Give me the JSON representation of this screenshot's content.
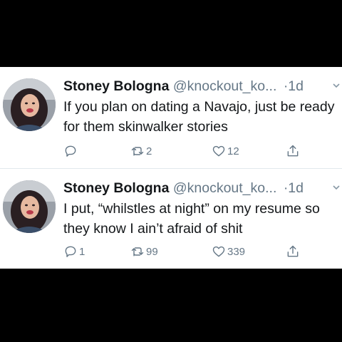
{
  "tweets": [
    {
      "name": "Stoney Bologna",
      "handle": "@knockout_ko...",
      "time": "·1d",
      "text": "If you plan on dating a Navajo, just be ready for them skinwalker stories",
      "replies": "",
      "retweets": "2",
      "likes": "12"
    },
    {
      "name": "Stoney Bologna",
      "handle": "@knockout_ko...",
      "time": "·1d",
      "text": "I put, “whilstles at night” on my resume so they know I ain’t afraid of shit",
      "replies": "1",
      "retweets": "99",
      "likes": "339"
    }
  ],
  "icons": {
    "reply": "reply-icon",
    "retweet": "retweet-icon",
    "like": "heart-icon",
    "share": "share-icon",
    "more": "chevron-down-icon"
  },
  "colors": {
    "text": "#14171a",
    "secondary": "#657786",
    "background": "#ffffff",
    "frame": "#000000"
  }
}
